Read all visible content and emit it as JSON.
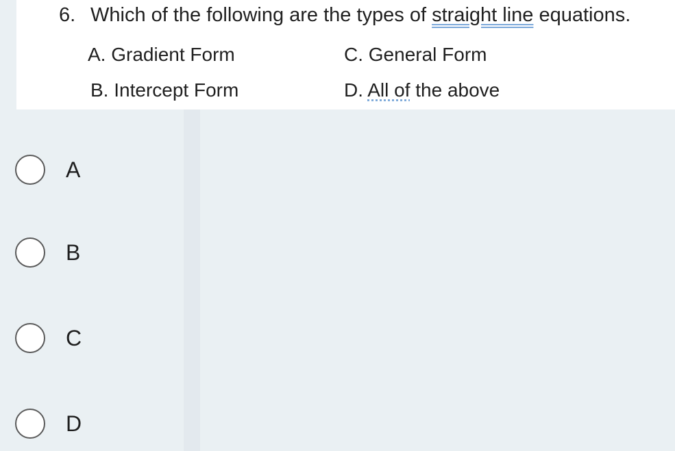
{
  "question": {
    "number": "6.",
    "text_before": "Which of the following are the types of ",
    "text_underlined": "straight line",
    "text_after": " equations.",
    "options": {
      "a": "A. Gradient Form",
      "b": "B. Intercept Form",
      "c": "C. General Form",
      "d_prefix": "D. ",
      "d_underlined": "All of",
      "d_suffix": " the above"
    }
  },
  "choices": [
    {
      "label": "A",
      "selected": false
    },
    {
      "label": "B",
      "selected": false
    },
    {
      "label": "C",
      "selected": false
    },
    {
      "label": "D",
      "selected": false
    }
  ],
  "colors": {
    "background": "#eaf0f3",
    "card": "#ffffff",
    "text": "#1f1f1f",
    "radio_border": "#5a5a5a",
    "underline": "#7aa7d9"
  }
}
